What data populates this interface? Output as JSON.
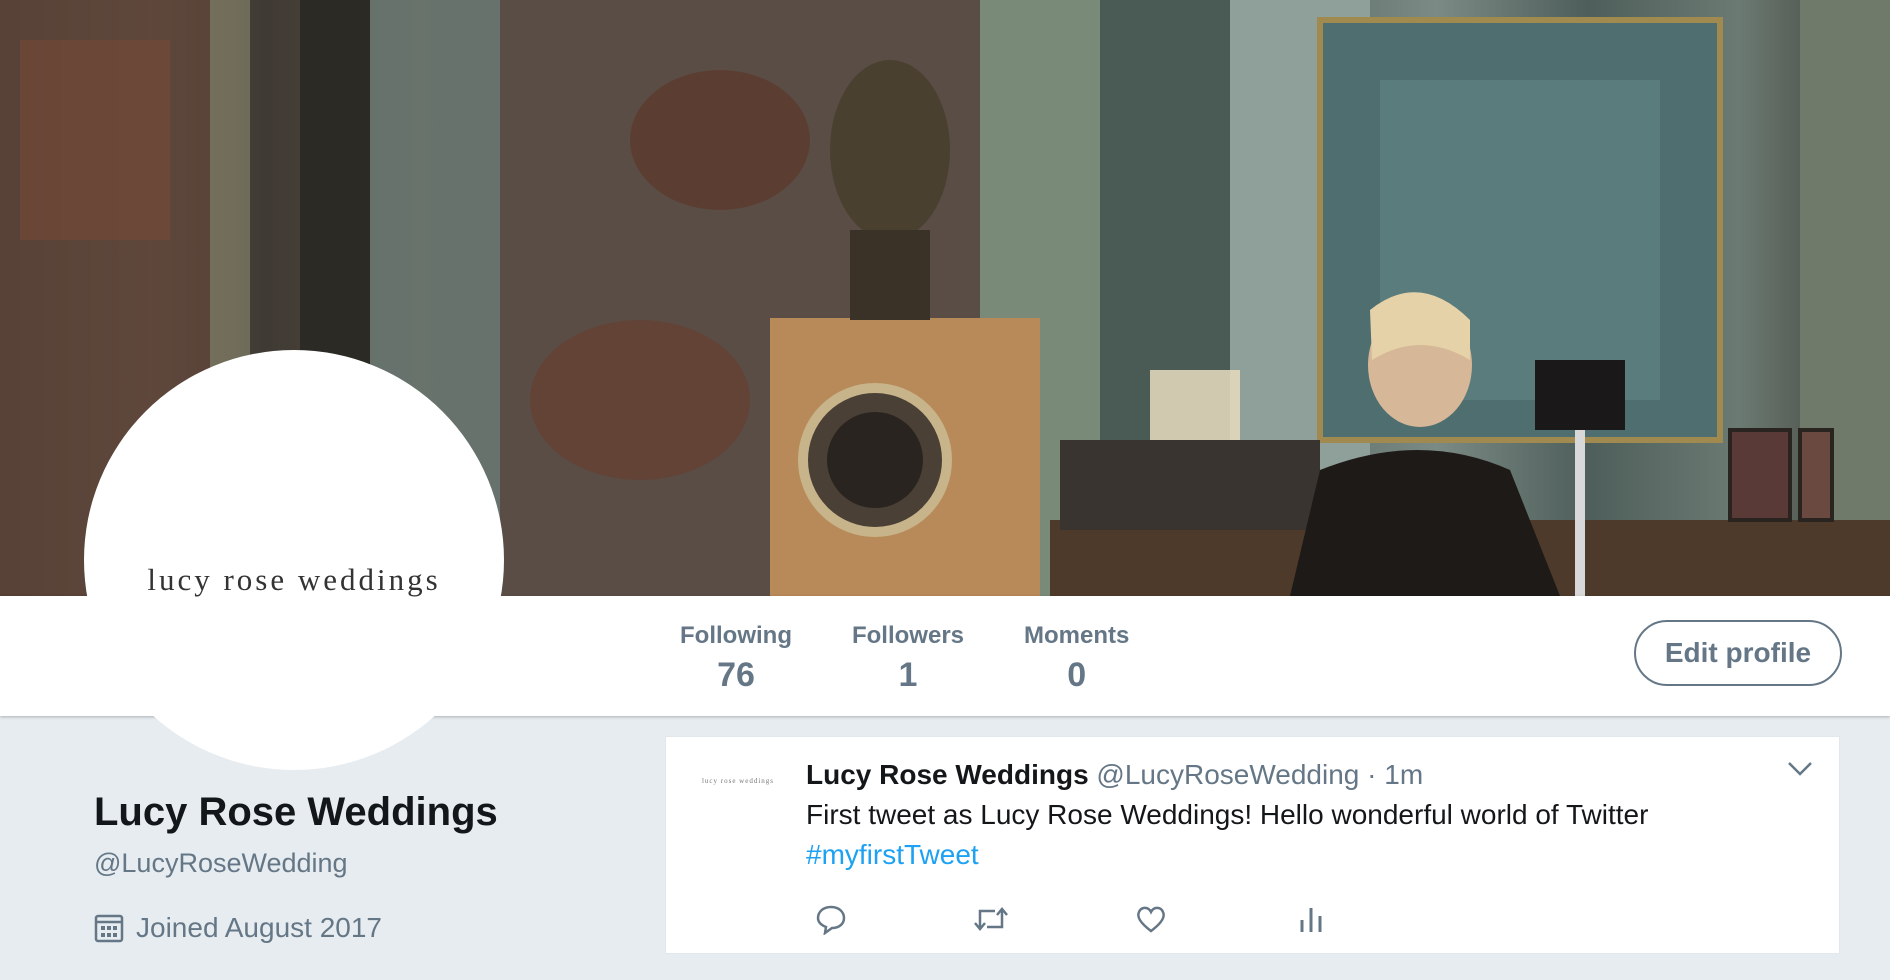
{
  "profile": {
    "avatar_text": "lucy rose weddings",
    "name": "Lucy Rose Weddings",
    "handle": "@LucyRoseWedding",
    "joined": "Joined August 2017"
  },
  "stats": [
    {
      "label": "Following",
      "value": "76"
    },
    {
      "label": "Followers",
      "value": "1"
    },
    {
      "label": "Moments",
      "value": "0"
    }
  ],
  "edit_button_label": "Edit profile",
  "tweet": {
    "avatar_text": "lucy rose weddings",
    "name": "Lucy Rose Weddings",
    "handle": "@LucyRoseWedding",
    "separator": " · ",
    "time": "1m",
    "text": "First tweet as Lucy Rose Weddings! Hello wonderful world of Twitter",
    "hashtag": "#myfirstTweet"
  },
  "icons": {
    "calendar": "calendar-icon",
    "caret": "chevron-down-icon",
    "reply": "reply-icon",
    "retweet": "retweet-icon",
    "like": "heart-icon",
    "analytics": "analytics-icon"
  },
  "colors": {
    "accent": "#1da1f2",
    "muted": "#657786",
    "background": "#e6ecf0"
  }
}
